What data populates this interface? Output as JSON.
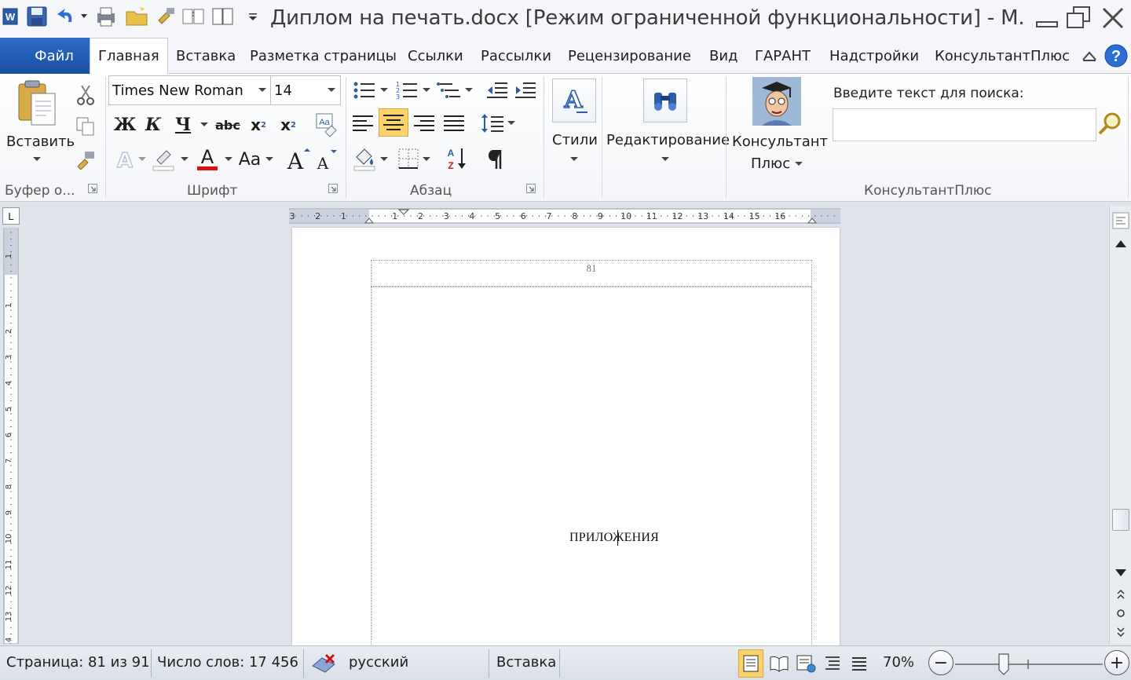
{
  "window": {
    "title": "Диплом на печать.docx [Режим ограниченной функциональности]  -  М."
  },
  "tabs": {
    "file": "Файл",
    "items": [
      "Главная",
      "Вставка",
      "Разметка страницы",
      "Ссылки",
      "Рассылки",
      "Рецензирование",
      "Вид",
      "ГАРАНТ",
      "Надстройки",
      "КонсультантПлюс"
    ],
    "active": "Главная"
  },
  "ribbon": {
    "clipboard": {
      "paste_label": "Вставить",
      "group": "Буфер о..."
    },
    "font": {
      "name": "Times New Roman",
      "size": "14",
      "group": "Шрифт",
      "bold": "Ж",
      "italic": "К",
      "underline": "Ч",
      "strike": "abc",
      "sub": "x",
      "sup": "x",
      "case": "Aa"
    },
    "paragraph": {
      "group": "Абзац"
    },
    "styles": {
      "label": "Стили"
    },
    "editing": {
      "label": "Редактирование"
    },
    "consultant": {
      "label_line1": "Консультант",
      "label_line2": "Плюс",
      "search_label": "Введите текст для поиска:",
      "search_value": "",
      "group": "КонсультантПлюс"
    },
    "accent_color": "#1a56b0",
    "highlight_color": "#fcd36a"
  },
  "ruler": {
    "corner": "L",
    "h_ticks": [
      "3",
      "2",
      "1",
      "1",
      "2",
      "3",
      "4",
      "5",
      "6",
      "7",
      "8",
      "9",
      "10",
      "11",
      "12",
      "13",
      "14",
      "15",
      "16"
    ],
    "v_ticks": [
      "1",
      "1",
      "2",
      "3",
      "4",
      "5",
      "6",
      "7",
      "8",
      "9",
      "10",
      "11",
      "12",
      "13",
      "14"
    ]
  },
  "document": {
    "page_number": "81",
    "text": "ПРИЛОЖЕНИЯ"
  },
  "status": {
    "page": "Страница: 81 из 91",
    "words": "Число слов: 17 456",
    "language": "русский",
    "mode": "Вставка",
    "zoom": "70%",
    "zoom_minus": "−",
    "zoom_plus": "+"
  }
}
